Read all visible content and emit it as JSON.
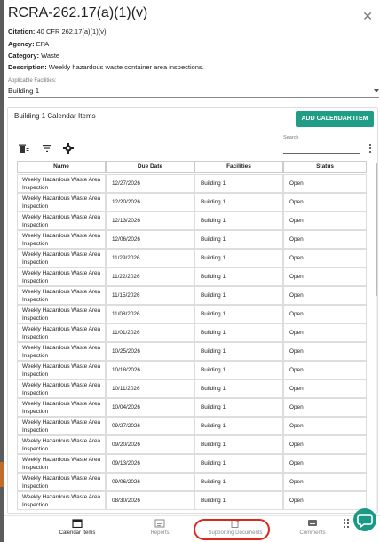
{
  "modal": {
    "title": "RCRA-262.17(a)(1)(v)",
    "close_icon": "close-icon"
  },
  "details": {
    "citation_label": "Citation:",
    "citation_value": "40 CFR 262.17(a)(1)(v)",
    "agency_label": "Agency:",
    "agency_value": "EPA",
    "category_label": "Category:",
    "category_value": "Waste",
    "description_label": "Description:",
    "description_value": "Weekly hazardous waste container area inspections."
  },
  "facilities": {
    "label": "Applicable Facilities:",
    "selected": "Building 1"
  },
  "calendar": {
    "title": "Building 1 Calendar Items",
    "add_button": "ADD CALENDAR ITEM",
    "search_label": "Search",
    "search_value": "",
    "tool_icons": [
      "delete-icon",
      "filter-icon",
      "gear-icon"
    ],
    "columns": [
      "Name",
      "Due Date",
      "Facilities",
      "Status"
    ],
    "rows": [
      {
        "name": "Weekly Hazardous Waste Area Inspection",
        "due": "12/27/2026",
        "facility": "Building 1",
        "status": "Open"
      },
      {
        "name": "Weekly Hazardous Waste Area Inspection",
        "due": "12/20/2026",
        "facility": "Building 1",
        "status": "Open"
      },
      {
        "name": "Weekly Hazardous Waste Area Inspection",
        "due": "12/13/2026",
        "facility": "Building 1",
        "status": "Open"
      },
      {
        "name": "Weekly Hazardous Waste Area Inspection",
        "due": "12/06/2026",
        "facility": "Building 1",
        "status": "Open"
      },
      {
        "name": "Weekly Hazardous Waste Area Inspection",
        "due": "11/29/2026",
        "facility": "Building 1",
        "status": "Open"
      },
      {
        "name": "Weekly Hazardous Waste Area Inspection",
        "due": "11/22/2026",
        "facility": "Building 1",
        "status": "Open"
      },
      {
        "name": "Weekly Hazardous Waste Area Inspection",
        "due": "11/15/2026",
        "facility": "Building 1",
        "status": "Open"
      },
      {
        "name": "Weekly Hazardous Waste Area Inspection",
        "due": "11/08/2026",
        "facility": "Building 1",
        "status": "Open"
      },
      {
        "name": "Weekly Hazardous Waste Area Inspection",
        "due": "11/01/2026",
        "facility": "Building 1",
        "status": "Open"
      },
      {
        "name": "Weekly Hazardous Waste Area Inspection",
        "due": "10/25/2026",
        "facility": "Building 1",
        "status": "Open"
      },
      {
        "name": "Weekly Hazardous Waste Area Inspection",
        "due": "10/18/2026",
        "facility": "Building 1",
        "status": "Open"
      },
      {
        "name": "Weekly Hazardous Waste Area Inspection",
        "due": "10/11/2026",
        "facility": "Building 1",
        "status": "Open"
      },
      {
        "name": "Weekly Hazardous Waste Area Inspection",
        "due": "10/04/2026",
        "facility": "Building 1",
        "status": "Open"
      },
      {
        "name": "Weekly Hazardous Waste Area Inspection",
        "due": "09/27/2026",
        "facility": "Building 1",
        "status": "Open"
      },
      {
        "name": "Weekly Hazardous Waste Area Inspection",
        "due": "09/20/2026",
        "facility": "Building 1",
        "status": "Open"
      },
      {
        "name": "Weekly Hazardous Waste Area Inspection",
        "due": "09/13/2026",
        "facility": "Building 1",
        "status": "Open"
      },
      {
        "name": "Weekly Hazardous Waste Area Inspection",
        "due": "09/06/2026",
        "facility": "Building 1",
        "status": "Open"
      },
      {
        "name": "Weekly Hazardous Waste Area Inspection",
        "due": "08/30/2026",
        "facility": "Building 1",
        "status": "Open"
      }
    ]
  },
  "bottom_nav": [
    {
      "label": "Calendar Items",
      "icon": "calendar-icon",
      "active": true
    },
    {
      "label": "Reports",
      "icon": "reports-icon",
      "active": false
    },
    {
      "label": "Supporting Documents",
      "icon": "add-document-icon",
      "active": false
    },
    {
      "label": "Comments",
      "icon": "comment-icon",
      "active": false
    }
  ],
  "colors": {
    "accent": "#1f9d85",
    "highlight": "#e0251b",
    "chat": "#1a9a86"
  }
}
